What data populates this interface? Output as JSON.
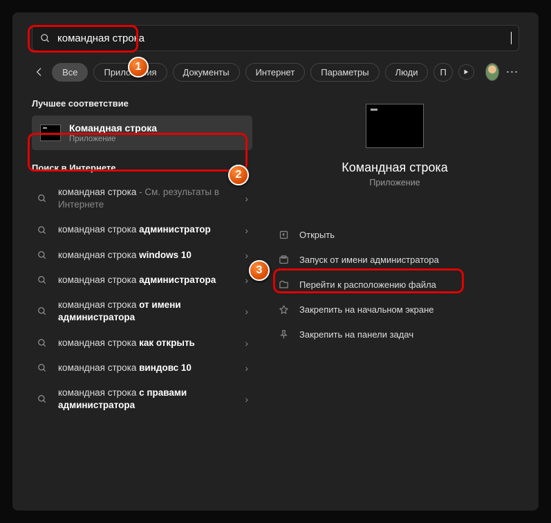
{
  "search": {
    "value": "командная строка"
  },
  "tabs": {
    "all": "Все",
    "apps": "Приложения",
    "docs": "Документы",
    "web": "Интернет",
    "settings": "Параметры",
    "people": "Люди",
    "more": "П"
  },
  "sections": {
    "best_match": "Лучшее соответствие",
    "web_search": "Поиск в Интернете"
  },
  "best": {
    "title": "Командная строка",
    "subtitle": "Приложение"
  },
  "web_items": [
    {
      "plain": "командная строка",
      "bold": "",
      "suffix_muted": " - См. результаты в Интернете"
    },
    {
      "plain": "командная строка ",
      "bold": "администратор",
      "suffix_muted": ""
    },
    {
      "plain": "командная строка ",
      "bold": "windows 10",
      "suffix_muted": ""
    },
    {
      "plain": "командная строка ",
      "bold": "администратора",
      "suffix_muted": ""
    },
    {
      "plain": "командная строка ",
      "bold": "от имени администратора",
      "suffix_muted": ""
    },
    {
      "plain": "командная строка ",
      "bold": "как открыть",
      "suffix_muted": ""
    },
    {
      "plain": "командная строка ",
      "bold": "виндовс 10",
      "suffix_muted": ""
    },
    {
      "plain": "командная строка ",
      "bold": "с правами администратора",
      "suffix_muted": ""
    }
  ],
  "preview": {
    "title": "Командная строка",
    "subtitle": "Приложение"
  },
  "actions": {
    "open": "Открыть",
    "run_admin": "Запуск от имени администратора",
    "open_location": "Перейти к расположению файла",
    "pin_start": "Закрепить на начальном экране",
    "pin_taskbar": "Закрепить на панели задач"
  },
  "badges": {
    "b1": "1",
    "b2": "2",
    "b3": "3"
  }
}
